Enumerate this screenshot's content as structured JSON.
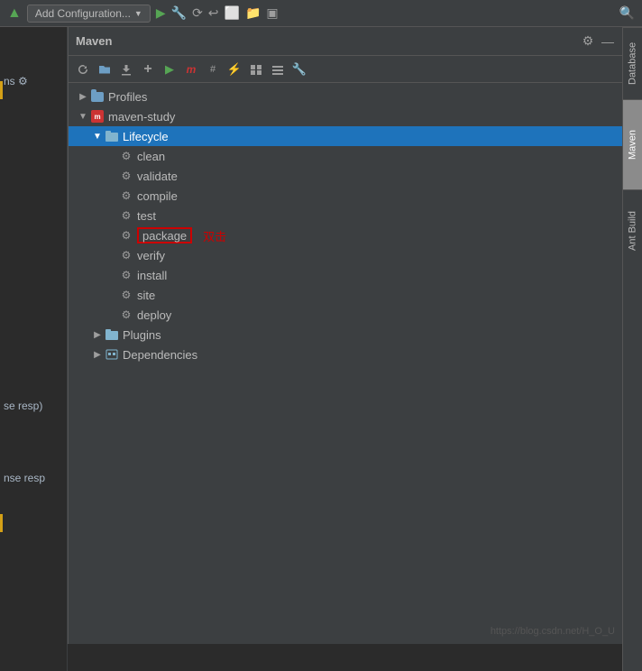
{
  "ide": {
    "title": "Maven",
    "toolbar": {
      "add_config_label": "Add Configuration...",
      "icons": [
        "play-icon",
        "wrench-icon",
        "reload-icon",
        "back-icon",
        "stop-icon",
        "folder-icon",
        "terminal-icon",
        "search-icon"
      ]
    }
  },
  "maven_panel": {
    "title": "Maven",
    "toolbar_icons": [
      "refresh-icon",
      "folder-open-icon",
      "download-icon",
      "add-icon",
      "run-icon",
      "maven-icon",
      "skip-tests-icon",
      "lightning-icon",
      "settings-icon",
      "toggle-icon",
      "wrench-icon"
    ],
    "header_icons": [
      "settings-icon",
      "minimize-icon"
    ]
  },
  "tree": {
    "items": [
      {
        "id": "profiles",
        "label": "Profiles",
        "indent": 1,
        "type": "folder",
        "expanded": false,
        "selected": false
      },
      {
        "id": "maven-study",
        "label": "maven-study",
        "indent": 1,
        "type": "maven",
        "expanded": true,
        "selected": false
      },
      {
        "id": "lifecycle",
        "label": "Lifecycle",
        "indent": 2,
        "type": "folder",
        "expanded": true,
        "selected": true
      },
      {
        "id": "clean",
        "label": "clean",
        "indent": 3,
        "type": "gear",
        "selected": false
      },
      {
        "id": "validate",
        "label": "validate",
        "indent": 3,
        "type": "gear",
        "selected": false
      },
      {
        "id": "compile",
        "label": "compile",
        "indent": 3,
        "type": "gear",
        "selected": false
      },
      {
        "id": "test",
        "label": "test",
        "indent": 3,
        "type": "gear",
        "selected": false
      },
      {
        "id": "package",
        "label": "package",
        "indent": 3,
        "type": "gear",
        "selected": false,
        "highlighted": true
      },
      {
        "id": "verify",
        "label": "verify",
        "indent": 3,
        "type": "gear",
        "selected": false
      },
      {
        "id": "install",
        "label": "install",
        "indent": 3,
        "type": "gear",
        "selected": false
      },
      {
        "id": "site",
        "label": "site",
        "indent": 3,
        "type": "gear",
        "selected": false
      },
      {
        "id": "deploy",
        "label": "deploy",
        "indent": 3,
        "type": "gear",
        "selected": false
      },
      {
        "id": "plugins",
        "label": "Plugins",
        "indent": 2,
        "type": "folder",
        "expanded": false,
        "selected": false
      },
      {
        "id": "dependencies",
        "label": "Dependencies",
        "indent": 2,
        "type": "folder",
        "expanded": false,
        "selected": false
      }
    ],
    "double_click_hint": "双击"
  },
  "right_sidebar": {
    "tabs": [
      {
        "id": "database",
        "label": "Database",
        "active": false
      },
      {
        "id": "maven",
        "label": "Maven",
        "active": true
      },
      {
        "id": "ant-build",
        "label": "Ant Build",
        "active": false
      }
    ]
  },
  "watermark": {
    "text": "https://blog.csdn.net/H_O_U"
  },
  "code_snippets": {
    "line1": "ns ⚙",
    "line2": "se resp)",
    "line3": "nse resp"
  }
}
